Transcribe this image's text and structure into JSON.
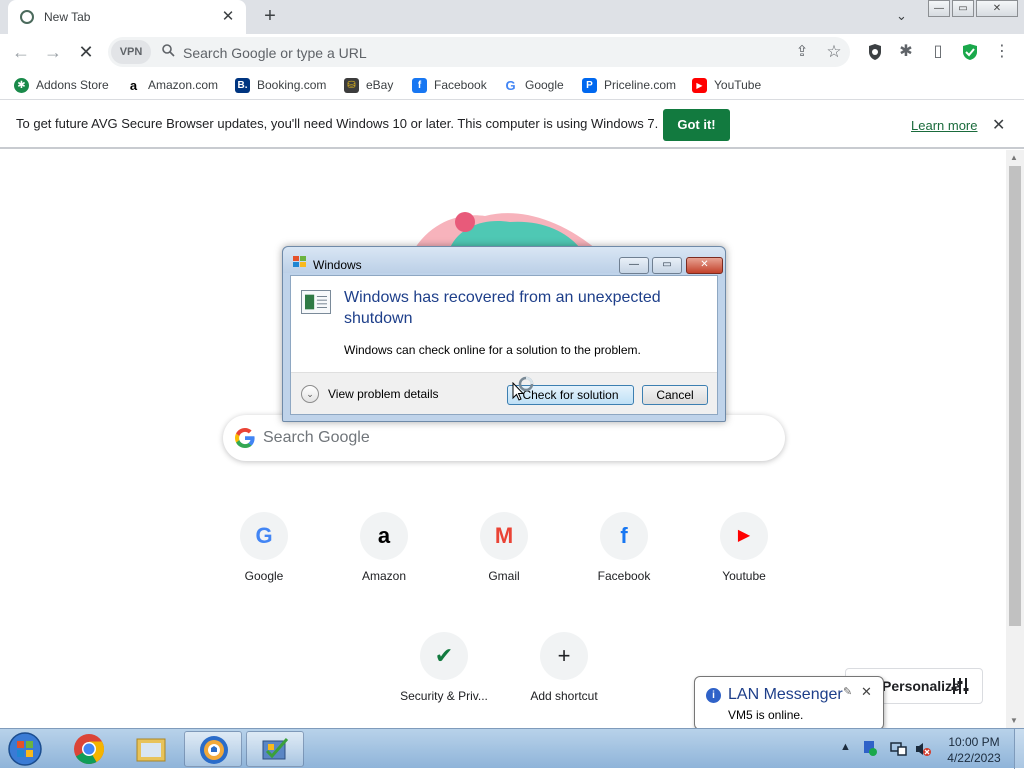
{
  "browser": {
    "tab": {
      "title": "New Tab",
      "close": "✕"
    },
    "new_tab": "+",
    "tab_search": "⌄",
    "window_buttons": {
      "minimize": "—",
      "maximize": "▭",
      "close": "✕"
    }
  },
  "toolbar": {
    "back": "←",
    "forward": "→",
    "stop": "✕",
    "vpn_label": "VPN",
    "omnibox_placeholder": "Search Google or type a URL",
    "share": "⇪",
    "bookmark_star": "☆",
    "extensions": "✱",
    "sidepanel": "▯",
    "menu": "⋮"
  },
  "bookmarks": [
    {
      "label": "Addons Store",
      "icon": "addons-store-icon",
      "color": "#1a8a4a",
      "glyph": "✱"
    },
    {
      "label": "Amazon.com",
      "icon": "amazon-icon",
      "color": "#ffffff",
      "glyph": "a"
    },
    {
      "label": "Booking.com",
      "icon": "booking-icon",
      "color": "#003580",
      "glyph": "B."
    },
    {
      "label": "eBay",
      "icon": "ebay-icon",
      "color": "#e43137",
      "glyph": "⛁"
    },
    {
      "label": "Facebook",
      "icon": "facebook-icon",
      "color": "#1877f2",
      "glyph": "f"
    },
    {
      "label": "Google",
      "icon": "google-icon",
      "color": "#ffffff",
      "glyph": "G"
    },
    {
      "label": "Priceline.com",
      "icon": "priceline-icon",
      "color": "#0068ef",
      "glyph": "P"
    },
    {
      "label": "YouTube",
      "icon": "youtube-icon",
      "color": "#ff0000",
      "glyph": "▶"
    }
  ],
  "infobar": {
    "message": "To get future AVG Secure Browser updates, you'll need Windows 10 or later. This computer is using Windows 7.",
    "button": "Got it!",
    "link": "Learn more",
    "close": "✕"
  },
  "newtab": {
    "search_placeholder": "Search Google",
    "shortcuts": [
      {
        "label": "Google",
        "icon": "google-icon",
        "glyph": "G",
        "color": "#4285f4"
      },
      {
        "label": "Amazon",
        "icon": "amazon-icon",
        "glyph": "a",
        "color": "#000000"
      },
      {
        "label": "Gmail",
        "icon": "gmail-icon",
        "glyph": "M",
        "color": "#ea4335"
      },
      {
        "label": "Facebook",
        "icon": "facebook-icon",
        "glyph": "f",
        "color": "#1877f2"
      },
      {
        "label": "Youtube",
        "icon": "youtube-icon",
        "glyph": "▶",
        "color": "#ff0000"
      },
      {
        "label": "Security & Priv...",
        "icon": "shield-icon",
        "glyph": "✔",
        "color": "#127a3f"
      },
      {
        "label": "Add shortcut",
        "icon": "plus-icon",
        "glyph": "+",
        "color": "#202124"
      }
    ],
    "personalize": "Personalize"
  },
  "dialog": {
    "title": "Windows",
    "heading": "Windows has recovered from an unexpected shutdown",
    "subtext": "Windows can check online for a solution to the problem.",
    "expander": "⌄",
    "details_label": "View problem details",
    "check_button": "Check for solution",
    "cancel_button": "Cancel",
    "minimize": "—",
    "maximize": "▭",
    "close": "✕"
  },
  "balloon": {
    "title": "LAN Messenger",
    "message": "VM5 is online.",
    "close": "✕",
    "wrench": "🔧"
  },
  "taskbar": {
    "time": "10:00 PM",
    "date": "4/22/2023",
    "tray_arrow": "▲"
  }
}
